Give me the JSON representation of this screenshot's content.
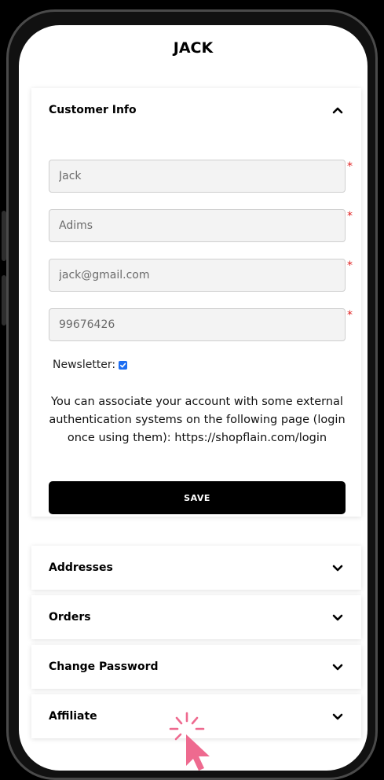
{
  "header": {
    "title": "JACK"
  },
  "sections": {
    "customer_info": {
      "title": "Customer Info",
      "first_name": "Jack",
      "last_name": "Adims",
      "email": "jack@gmail.com",
      "phone": "99676426",
      "required_marker": "*",
      "newsletter_label": "Newsletter:",
      "newsletter_checked": true,
      "info_text": "You can associate your account with some external authentication systems on the following page (login once using them): https://shopflain.com/login",
      "save_label": "SAVE"
    },
    "addresses": {
      "title": "Addresses"
    },
    "orders": {
      "title": "Orders"
    },
    "change_password": {
      "title": "Change Password"
    },
    "affiliate": {
      "title": "Affiliate"
    }
  },
  "colors": {
    "accent": "#1d6df1",
    "required": "#e02020",
    "cursor": "#ee6a8f",
    "button": "#000000"
  },
  "icons": {
    "expand_open": "chevron-up-icon",
    "expand_closed": "chevron-down-icon",
    "pointer": "hand-pointer-icon"
  }
}
